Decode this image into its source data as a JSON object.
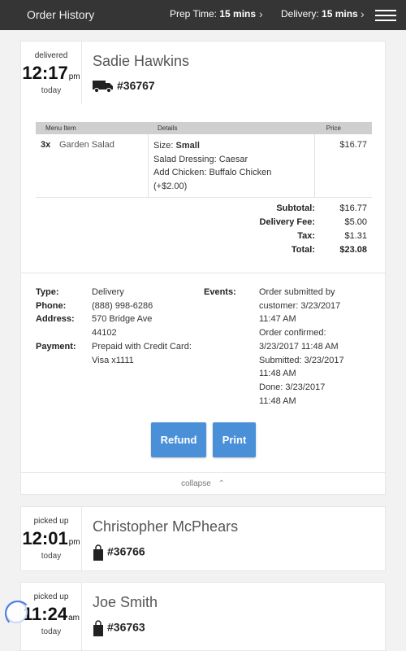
{
  "header": {
    "title": "Order History",
    "prep_label": "Prep Time:",
    "prep_value": "15 mins",
    "delivery_label": "Delivery:",
    "delivery_value": "15 mins",
    "chevron": "›"
  },
  "orders": [
    {
      "status": "delivered",
      "time": "12:17",
      "ampm": "pm",
      "day": "today",
      "customer": "Sadie Hawkins",
      "number": "#36767",
      "icon": "delivery-truck-icon",
      "expanded": true,
      "table_headers": {
        "item": "Menu Item",
        "details": "Details",
        "price": "Price"
      },
      "items": [
        {
          "qty": "3x",
          "name": "Garden Salad",
          "size_label": "Size:",
          "size_value": "Small",
          "detail_line_1": "Salad Dressing: Caesar",
          "detail_line_2": "Add Chicken: Buffalo Chicken",
          "detail_line_3": "(+$2.00)",
          "price": "$16.77"
        }
      ],
      "totals": [
        {
          "label": "Subtotal:",
          "value": "$16.77"
        },
        {
          "label": "Delivery Fee:",
          "value": "$5.00"
        },
        {
          "label": "Tax:",
          "value": "$1.31"
        },
        {
          "label": "Total:",
          "value": "$23.08"
        }
      ],
      "info": {
        "type_label": "Type:",
        "type_value": "Delivery",
        "phone_label": "Phone:",
        "phone_value": "(888) 998-6286",
        "address_label": "Address:",
        "address_line_1": "570 Bridge Ave",
        "address_line_2": "44102",
        "payment_label": "Payment:",
        "payment_line_1": "Prepaid with Credit Card:",
        "payment_line_2": "Visa x1111",
        "events_label": "Events:",
        "events": [
          "Order submitted by",
          "customer: 3/23/2017",
          "11:47 AM",
          "Order confirmed:",
          "3/23/2017 11:48 AM",
          "Submitted: 3/23/2017",
          "11:48 AM",
          "Done: 3/23/2017",
          "11:48 AM"
        ]
      },
      "refund_label": "Refund",
      "print_label": "Print",
      "collapse_label": "collapse"
    },
    {
      "status": "picked up",
      "time": "12:01",
      "ampm": "pm",
      "day": "today",
      "customer": "Christopher McPhears",
      "number": "#36766",
      "icon": "shopping-bag-icon"
    },
    {
      "status": "picked up",
      "time": "11:24",
      "ampm": "am",
      "day": "today",
      "customer": "Joe Smith",
      "number": "#36763",
      "icon": "shopping-bag-icon"
    }
  ],
  "colors": {
    "accent": "#4a90d9",
    "topbar": "#353535"
  }
}
